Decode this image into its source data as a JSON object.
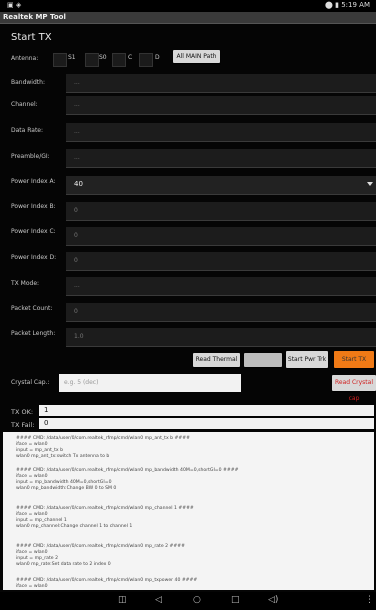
{
  "status_bar": {
    "time": "5:19 AM"
  },
  "app": {
    "title": "Realtek MP Tool"
  },
  "section_title": "Start TX",
  "antenna": {
    "label": "Antenna:",
    "options": [
      "S1",
      "S0",
      "C",
      "D"
    ],
    "all_main_path_label": "All MAIN Path"
  },
  "bandwidth": {
    "label": "Bandwidth:",
    "value": "..."
  },
  "channel": {
    "label": "Channel:",
    "value": "..."
  },
  "data_rate": {
    "label": "Data Rate:",
    "value": "..."
  },
  "preamble_gi": {
    "label": "Preamble/GI:",
    "value": "..."
  },
  "power_index_a": {
    "label": "Power Index A:",
    "value": "40"
  },
  "power_index_b": {
    "label": "Power Index B:",
    "value": "0"
  },
  "power_index_c": {
    "label": "Power Index C:",
    "value": "0"
  },
  "power_index_d": {
    "label": "Power Index D:",
    "value": "0"
  },
  "tx_mode": {
    "label": "TX Mode:",
    "value": "..."
  },
  "packet_count": {
    "label": "Packet Count:",
    "value": "0"
  },
  "packet_length": {
    "label": "Packet Length:",
    "value": "1.0"
  },
  "buttons": {
    "read_thermal": "Read Thermal",
    "blank": "",
    "start_pwr_trk": "Start Pwr Trk",
    "start_tx": "Start TX"
  },
  "crystal_cap": {
    "label": "Crystal Cap.:",
    "placeholder": "e.g. 5 (dec)",
    "read_button": "Read Crystal cap"
  },
  "tx_ok": {
    "label": "TX OK:",
    "value": "1"
  },
  "tx_fail": {
    "label": "TX Fail:",
    "value": "0"
  },
  "log_lines": [
    "#### CMD: /data/user/0/com.realtek_rfmp/cmd/wlan0 mp_ant_tx b ####",
    "iface = wlan0",
    "input = mp_ant_tx b",
    "wlan0   mp_ant_tx:switch Tx antenna to b",
    "#### CMD: /data/user/0/com.realtek_rfmp/cmd/wlan0 mp_bandwidth 40M=0,shortGI=0 ####",
    "iface = wlan0",
    "input = mp_bandwidth 40M=0,shortGI=0",
    "wlan0   mp_bandwidth:Change BW 0 to SM 0",
    "#### CMD: /data/user/0/com.realtek_rfmp/cmd/wlan0 mp_channel 1 ####",
    "iface = wlan0",
    "input = mp_channel 1",
    "wlan0   mp_channel:Change channel 1 to channel 1",
    "#### CMD: /data/user/0/com.realtek_rfmp/cmd/wlan0 mp_rate 2 ####",
    "iface = wlan0",
    "input = mp_rate 2",
    "wlan0   mp_rate:Set data rate to 2 index 0",
    "#### CMD: /data/user/0/com.realtek_rfmp/cmd/wlan0 mp_txpower 40 ####",
    "iface = wlan0"
  ]
}
